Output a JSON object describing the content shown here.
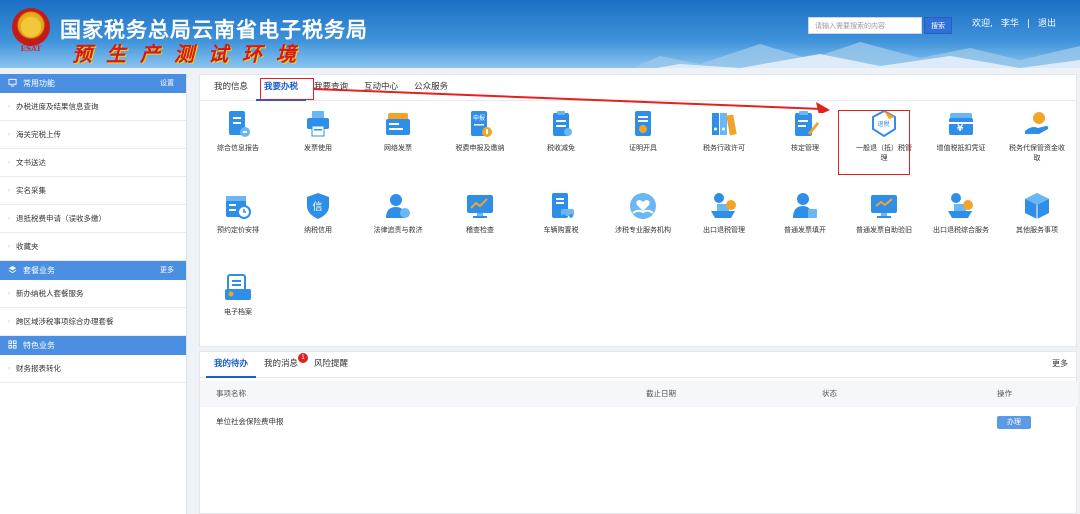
{
  "header": {
    "title": "国家税务总局云南省电子税务局",
    "subtitle": "预生产测试环境",
    "emblem_text": "ESAT",
    "search_placeholder": "请输入需要搜索的内容",
    "search_button": "搜索",
    "welcome": "欢迎,",
    "username": "李华",
    "separator": "|",
    "logout": "退出"
  },
  "sidebar": {
    "sections": [
      {
        "title": "常用功能",
        "more": "设置",
        "icon": "monitor-icon",
        "items": [
          "办税进度及结果信息查询",
          "海关完税上传",
          "文书送达",
          "实名采集",
          "退抵税费申请（误收多缴）",
          "收藏夹"
        ]
      },
      {
        "title": "套餐业务",
        "more": "更多",
        "icon": "layers-icon",
        "items": [
          "新办纳税人套餐服务",
          "跨区域涉税事项综合办理套餐"
        ]
      },
      {
        "title": "特色业务",
        "more": "",
        "icon": "grid-icon",
        "items": [
          "财务报表转化"
        ]
      }
    ]
  },
  "main_tabs": [
    "我的信息",
    "我要办税",
    "我要查询",
    "互动中心",
    "公众服务"
  ],
  "active_main_tab": "我要办税",
  "services": [
    {
      "label": "综合信息报告",
      "icon": "report-icon"
    },
    {
      "label": "发票使用",
      "icon": "printer-icon"
    },
    {
      "label": "网络发票",
      "icon": "network-invoice-icon"
    },
    {
      "label": "税费申报及缴纳",
      "icon": "declare-icon"
    },
    {
      "label": "税收减免",
      "icon": "tax-reduction-icon"
    },
    {
      "label": "证明开具",
      "icon": "certificate-icon"
    },
    {
      "label": "税务行政许可",
      "icon": "binders-icon"
    },
    {
      "label": "核定管理",
      "icon": "clipboard-edit-icon"
    },
    {
      "label": "一般退（抵）税管理",
      "icon": "refund-icon",
      "icon_text": "退税"
    },
    {
      "label": "增值税抵扣凭证",
      "icon": "vat-deduction-icon"
    },
    {
      "label": "税务代保管资金收取",
      "icon": "hand-coin-icon"
    },
    {
      "label": "预约定价安排",
      "icon": "calendar-clock-icon"
    },
    {
      "label": "纳税信用",
      "icon": "credit-shield-icon",
      "icon_text": "信"
    },
    {
      "label": "法律追责与救济",
      "icon": "person-law-icon"
    },
    {
      "label": "稽查检查",
      "icon": "monitor-chart-icon"
    },
    {
      "label": "车辆购置税",
      "icon": "vehicle-tax-icon"
    },
    {
      "label": "涉税专业服务机构",
      "icon": "heart-hand-icon"
    },
    {
      "label": "出口退税管理",
      "icon": "ship-export-icon"
    },
    {
      "label": "普通发票填开",
      "icon": "person-invoice-icon"
    },
    {
      "label": "普通发票自助验旧",
      "icon": "monitor-check-icon"
    },
    {
      "label": "出口退税综合服务",
      "icon": "ship-service-icon"
    },
    {
      "label": "其他服务事项",
      "icon": "cube-icon"
    },
    {
      "label": "电子档案",
      "icon": "archive-icon"
    }
  ],
  "todo": {
    "tabs": [
      "我的待办",
      "我的消息",
      "风险提醒"
    ],
    "active_tab": "我的待办",
    "message_count": "1",
    "more": "更多",
    "columns": [
      "事项名称",
      "截止日期",
      "状态",
      "操作"
    ],
    "rows": [
      {
        "name": "单位社会保险费申报",
        "deadline": "",
        "status": "",
        "action": "办理"
      }
    ]
  },
  "colors": {
    "primary": "#1a5fc8",
    "header_blue": "#1a6fc4",
    "icon_blue": "#2e8ee8",
    "highlight_red": "#e61f1f",
    "sidebar_head": "#4a8fe2"
  }
}
